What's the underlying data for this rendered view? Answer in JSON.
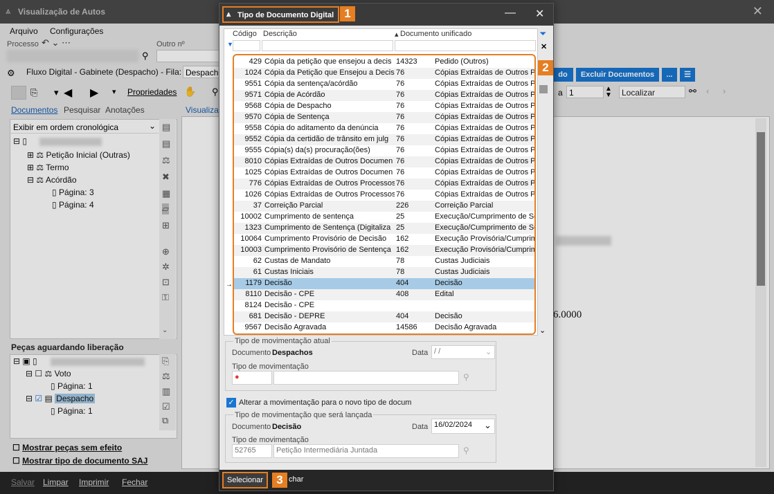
{
  "main": {
    "title": "Visualização de Autos",
    "menu": [
      "Arquivo",
      "Configurações"
    ],
    "processo_label": "Processo",
    "outro_label": "Outro nº",
    "fluxo_text": "Fluxo Digital - Gabinete (Despacho) - Fila:",
    "fila_value": "Despacho",
    "propriedades": "Propriedades",
    "tabs": [
      "Documentos",
      "Pesquisar",
      "Anotações"
    ],
    "view_tab": "Visualizaç",
    "order_select": "Exibir em ordem cronológica",
    "tree": [
      "Petição Inicial (Outras)",
      "Termo",
      "Acórdão",
      "Página: 3",
      "Página: 4"
    ],
    "pecas_title": "Peças aguardando liberação",
    "pecas_tree": [
      "Voto",
      "Página: 1",
      "Despacho",
      "Página: 1"
    ],
    "mostrar_sem_efeito": "Mostrar peças sem efeito",
    "mostrar_tipo": "Mostrar tipo de documento SAJ",
    "excluir_btn": "Excluir Documentos",
    "more_btn": "...",
    "page_label": "a",
    "page_value": "1",
    "localizar_placeholder": "Localizar",
    "partial_btn": "do",
    "doc_text": "6.0000",
    "status": [
      "Salvar",
      "Limpar",
      "Imprimir",
      "Fechar"
    ]
  },
  "dialog": {
    "title": "Tipo de Documento Digital",
    "badges": [
      "1",
      "2",
      "3"
    ],
    "columns": [
      "Código",
      "Descrição",
      "Documento unificado"
    ],
    "rows": [
      {
        "codigo": "429",
        "descricao": "Cópia da petição que ensejou a decis",
        "num": "14323",
        "unificado": "Pedido (Outros)"
      },
      {
        "codigo": "1024",
        "descricao": "Cópia da Petição que Ensejou a Decis",
        "num": "76",
        "unificado": "Cópias Extraídas de Outros P"
      },
      {
        "codigo": "9551",
        "descricao": "Cópia da sentença/acórdão",
        "num": "76",
        "unificado": "Cópias Extraídas de Outros P"
      },
      {
        "codigo": "9571",
        "descricao": "Cópia de Acórdão",
        "num": "76",
        "unificado": "Cópias Extraídas de Outros P"
      },
      {
        "codigo": "9568",
        "descricao": "Cópia de Despacho",
        "num": "76",
        "unificado": "Cópias Extraídas de Outros P"
      },
      {
        "codigo": "9570",
        "descricao": "Cópia de Sentença",
        "num": "76",
        "unificado": "Cópias Extraídas de Outros P"
      },
      {
        "codigo": "9558",
        "descricao": "Cópia do aditamento da denúncia",
        "num": "76",
        "unificado": "Cópias Extraídas de Outros P"
      },
      {
        "codigo": "9552",
        "descricao": "Cópia da certidão de trânsito em julg",
        "num": "76",
        "unificado": "Cópias Extraídas de Outros P"
      },
      {
        "codigo": "9555",
        "descricao": "Cópia(s) da(s) procuração(ões)",
        "num": "76",
        "unificado": "Cópias Extraídas de Outros P"
      },
      {
        "codigo": "8010",
        "descricao": "Cópias Extraídas de Outros Documen",
        "num": "76",
        "unificado": "Cópias Extraídas de Outros P"
      },
      {
        "codigo": "1025",
        "descricao": "Cópias Extraídas de Outros Documen",
        "num": "76",
        "unificado": "Cópias Extraídas de Outros P"
      },
      {
        "codigo": "776",
        "descricao": "Cópias Extraídas de Outros Processos",
        "num": "76",
        "unificado": "Cópias Extraídas de Outros P"
      },
      {
        "codigo": "1026",
        "descricao": "Cópias Extraídas de Outros Processos",
        "num": "76",
        "unificado": "Cópias Extraídas de Outros P"
      },
      {
        "codigo": "37",
        "descricao": "Correição Parcial",
        "num": "226",
        "unificado": "Correição Parcial"
      },
      {
        "codigo": "10002",
        "descricao": "Cumprimento de sentença",
        "num": "25",
        "unificado": "Execução/Cumprimento de Se"
      },
      {
        "codigo": "1323",
        "descricao": "Cumprimento de Sentença (Digitaliza",
        "num": "25",
        "unificado": "Execução/Cumprimento de Se"
      },
      {
        "codigo": "10064",
        "descricao": "Cumprimento Provisório de Decisão",
        "num": "162",
        "unificado": "Execução Provisória/Cumprim"
      },
      {
        "codigo": "10003",
        "descricao": "Cumprimento Provisório de Sentença",
        "num": "162",
        "unificado": "Execução Provisória/Cumprim"
      },
      {
        "codigo": "62",
        "descricao": "Custas de Mandato",
        "num": "78",
        "unificado": "Custas Judiciais"
      },
      {
        "codigo": "61",
        "descricao": "Custas Iniciais",
        "num": "78",
        "unificado": "Custas Judiciais"
      },
      {
        "codigo": "1179",
        "descricao": "Decisão",
        "num": "404",
        "unificado": "Decisão"
      },
      {
        "codigo": "8110",
        "descricao": "Decisão - CPE",
        "num": "408",
        "unificado": "Edital"
      },
      {
        "codigo": "8124",
        "descricao": "Decisão - CPE",
        "num": "",
        "unificado": ""
      },
      {
        "codigo": "681",
        "descricao": "Decisão - DEPRE",
        "num": "404",
        "unificado": "Decisão"
      },
      {
        "codigo": "9567",
        "descricao": "Decisão Agravada",
        "num": "14586",
        "unificado": "Decisão Agravada"
      }
    ],
    "selected_index": 20,
    "atual_legend": "Tipo de movimentação atual",
    "documento_label": "Documento",
    "atual_documento": "Despachos",
    "data_label": "Data",
    "atual_data": " / /",
    "tipo_mov_label": "Tipo de movimentação",
    "alterar_checkbox": "Alterar a movimentação para o novo tipo de docum",
    "nova_legend": "Tipo de movimentação que será lançada",
    "nova_documento": "Decisão",
    "nova_data": "16/02/2024",
    "nova_mov_code": "52765",
    "nova_mov_desc": "Petição Intermediária Juntada",
    "selecionar": "Selecionar",
    "fechar_partial": "char"
  },
  "colors": {
    "accent": "#e67e22",
    "selection": "#a7cbe6",
    "blue_button": "#1976d2"
  }
}
